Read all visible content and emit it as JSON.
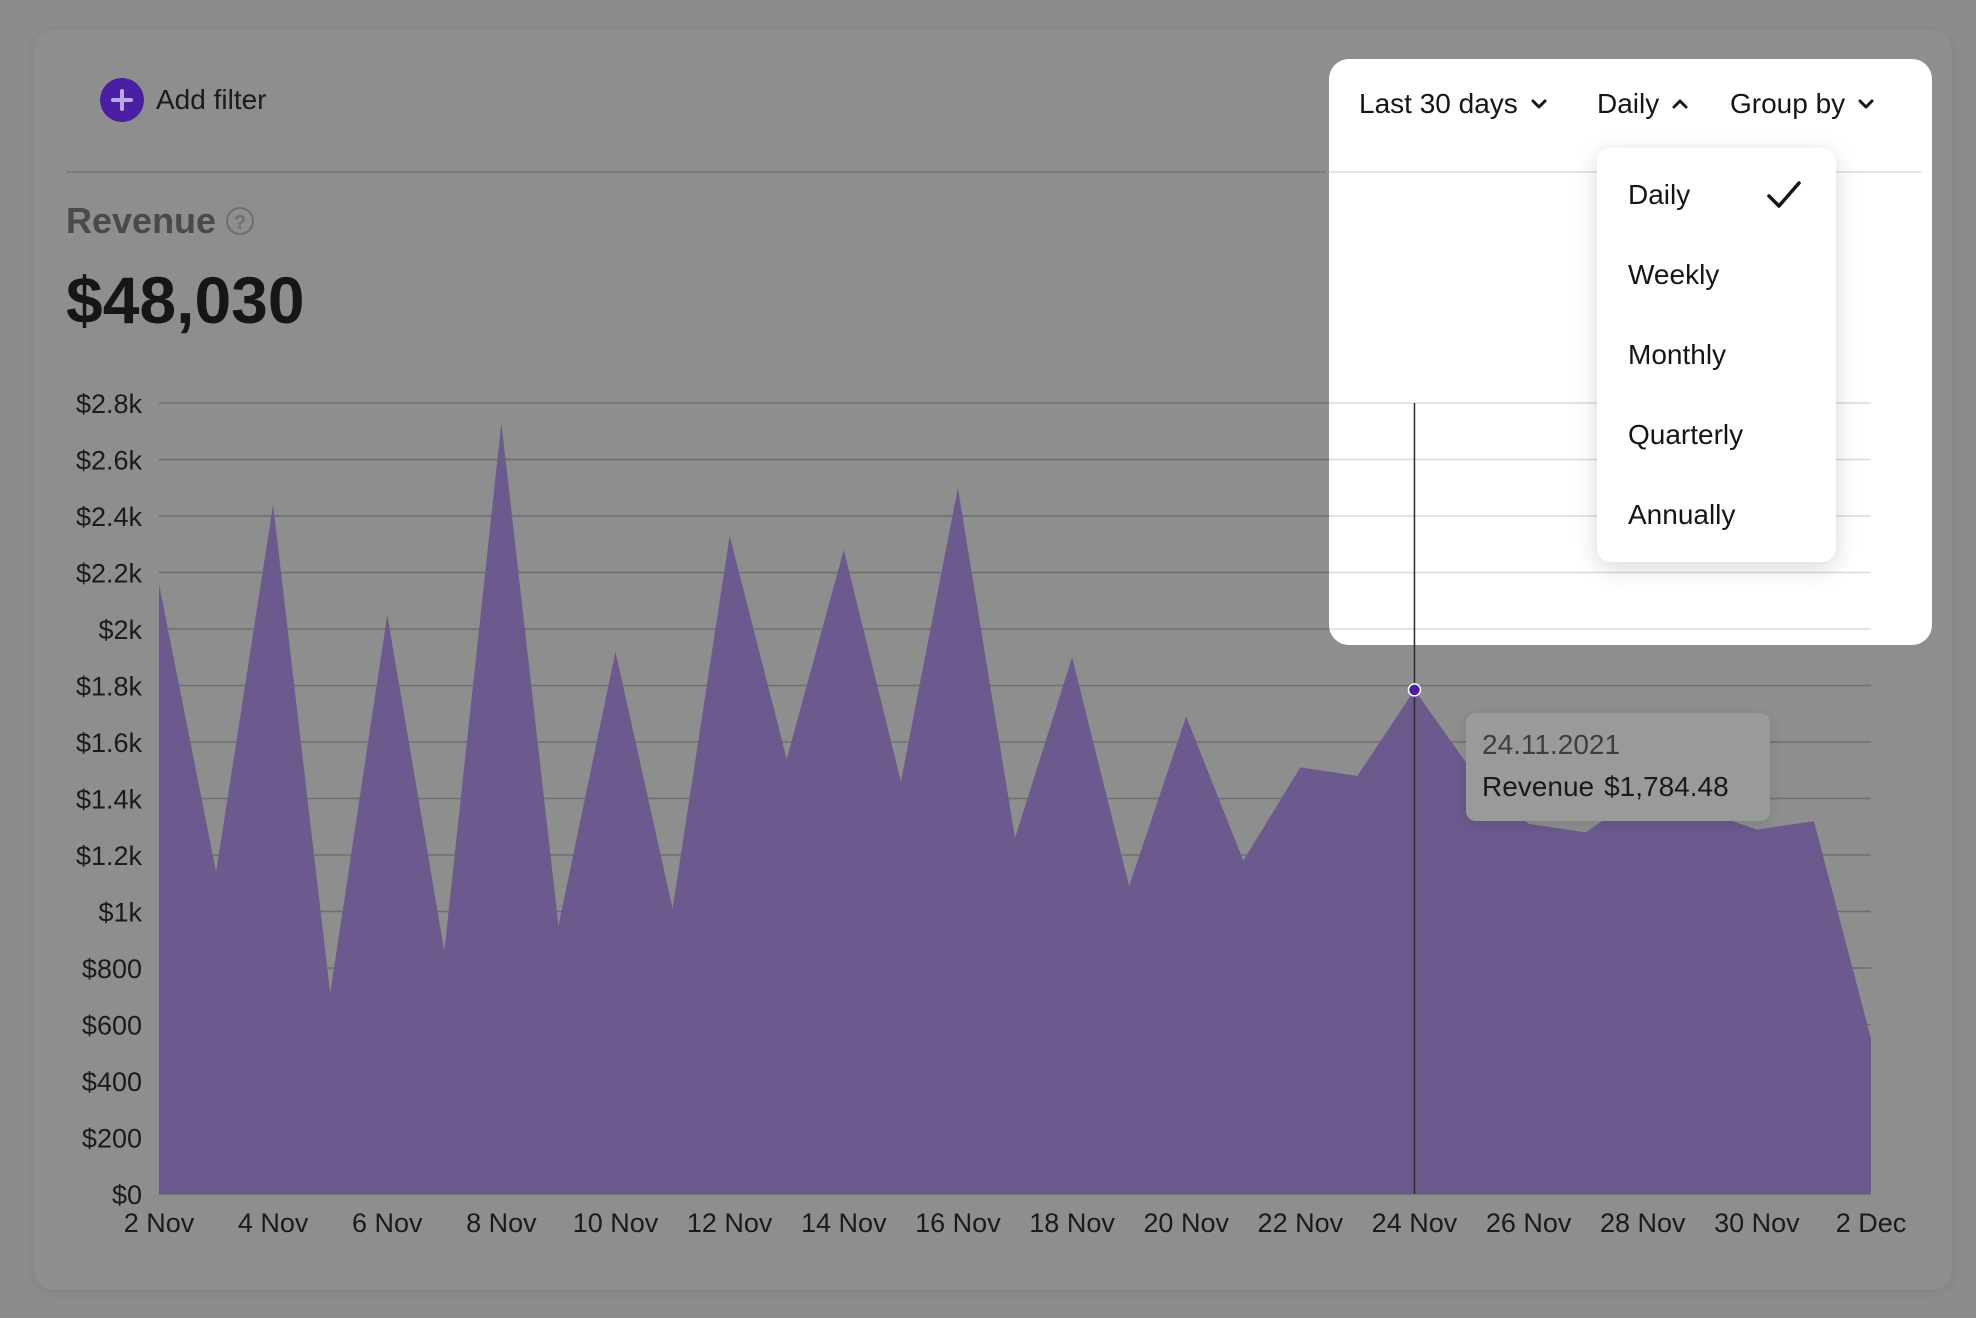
{
  "toolbar": {
    "add_filter_label": "Add filter",
    "range_label": "Last 30 days",
    "interval_label": "Daily",
    "group_by_label": "Group by"
  },
  "metric": {
    "title": "Revenue",
    "help_symbol": "?",
    "total": "$48,030"
  },
  "interval_menu": {
    "items": [
      "Daily",
      "Weekly",
      "Monthly",
      "Quarterly",
      "Annually"
    ],
    "selected": "Daily"
  },
  "tooltip": {
    "date": "24.11.2021",
    "series": "Revenue",
    "value": "$1,784.48"
  },
  "colors": {
    "accent": "#4a1fa3",
    "area_fill": "#6c5a8e",
    "gridline": "#6e6e6e"
  },
  "chart_data": {
    "type": "area",
    "x_tick_labels": [
      "2 Nov",
      "4 Nov",
      "6 Nov",
      "8 Nov",
      "10 Nov",
      "12 Nov",
      "14 Nov",
      "16 Nov",
      "18 Nov",
      "20 Nov",
      "22 Nov",
      "24 Nov",
      "26 Nov",
      "28 Nov",
      "30 Nov",
      "2 Dec"
    ],
    "y_tick_labels": [
      "$0",
      "$200",
      "$400",
      "$600",
      "$800",
      "$1k",
      "$1.2k",
      "$1.4k",
      "$1.6k",
      "$1.8k",
      "$2k",
      "$2.2k",
      "$2.4k",
      "$2.6k",
      "$2.8k"
    ],
    "ylim": [
      0,
      2800
    ],
    "series": [
      {
        "x": [
          "2 Nov",
          "3 Nov",
          "4 Nov",
          "5 Nov",
          "6 Nov",
          "7 Nov",
          "8 Nov",
          "9 Nov",
          "10 Nov",
          "11 Nov",
          "12 Nov",
          "13 Nov",
          "14 Nov",
          "15 Nov",
          "16 Nov",
          "17 Nov",
          "18 Nov",
          "19 Nov",
          "20 Nov",
          "21 Nov",
          "22 Nov",
          "23 Nov",
          "24 Nov",
          "25 Nov",
          "26 Nov",
          "27 Nov",
          "28 Nov",
          "29 Nov",
          "30 Nov",
          "1 Dec",
          "2 Dec"
        ],
        "values": [
          2160,
          1140,
          2440,
          710,
          2050,
          860,
          2730,
          950,
          1920,
          1010,
          2330,
          1540,
          2280,
          1460,
          2500,
          1260,
          1900,
          1090,
          1690,
          1180,
          1510,
          1480,
          1784.48,
          1500,
          1310,
          1280,
          1420,
          1360,
          1290,
          1320,
          550
        ]
      }
    ],
    "highlight": {
      "x": "24 Nov",
      "value": 1784.48
    },
    "grid": true,
    "legend": "none"
  }
}
